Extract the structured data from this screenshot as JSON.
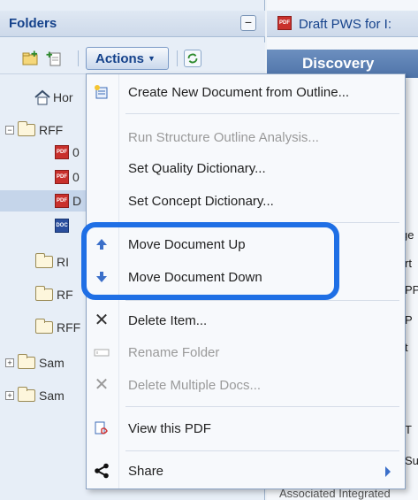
{
  "folders_panel": {
    "title": "Folders",
    "collapse_glyph": "−",
    "actions_label": "Actions",
    "tree": [
      {
        "label": "Hor",
        "type": "home"
      },
      {
        "label": "RFF",
        "type": "folder-open"
      },
      {
        "label": "0",
        "type": "pdf"
      },
      {
        "label": "0",
        "type": "pdf"
      },
      {
        "label": "D",
        "type": "pdf"
      },
      {
        "label": "",
        "type": "doc"
      },
      {
        "label": "RI",
        "type": "folder"
      },
      {
        "label": "RF",
        "type": "folder"
      },
      {
        "label": "RFF",
        "type": "folder"
      },
      {
        "label": "Sam",
        "type": "folder-collapsed"
      },
      {
        "label": "Sam",
        "type": "folder-collapsed"
      }
    ]
  },
  "right_panel": {
    "doc_title": "Draft PWS for I:",
    "tab": "Discovery",
    "fragments": [
      "ge",
      "rt",
      "PP",
      "P",
      "t",
      "T",
      "Su",
      "Associated Integrated"
    ]
  },
  "actions_menu": {
    "items": [
      {
        "label": "Create New Document from Outline...",
        "icon": "new-doc-icon",
        "enabled": true
      },
      {
        "label": "Run Structure Outline Analysis...",
        "icon": "",
        "enabled": false
      },
      {
        "label": "Set Quality Dictionary...",
        "icon": "",
        "enabled": true
      },
      {
        "label": "Set Concept Dictionary...",
        "icon": "",
        "enabled": true
      },
      {
        "label": "Move Document Up",
        "icon": "arrow-up-icon",
        "enabled": true
      },
      {
        "label": "Move Document Down",
        "icon": "arrow-down-icon",
        "enabled": true
      },
      {
        "label": "Delete Item...",
        "icon": "x-icon",
        "enabled": true
      },
      {
        "label": "Rename Folder",
        "icon": "rename-icon",
        "enabled": false
      },
      {
        "label": "Delete Multiple Docs...",
        "icon": "x-icon",
        "enabled": false
      },
      {
        "label": "View this PDF",
        "icon": "pdf-view-icon",
        "enabled": true
      },
      {
        "label": "Share",
        "icon": "share-icon",
        "enabled": true
      }
    ]
  },
  "colors": {
    "highlight": "#1f6fe5",
    "header_text": "#15428b"
  }
}
